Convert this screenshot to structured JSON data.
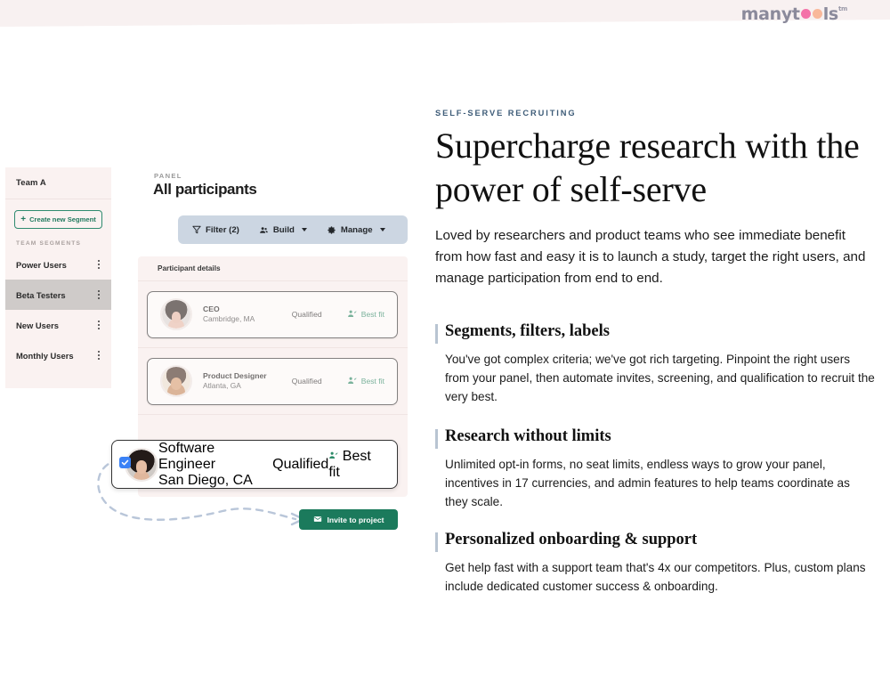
{
  "brand": {
    "logo_part1": "manyt",
    "logo_part2": "ls",
    "logo_tm": "tm",
    "dot_pink": "#f472a8",
    "dot_peach": "#f9b89a",
    "logo_text_color": "#8b8a9b"
  },
  "content": {
    "eyebrow": "SELF-SERVE RECRUITING",
    "eyebrow_color": "#3e5c78",
    "heading": "Supercharge research with the power of self-serve",
    "lede": "Loved by researchers and product teams who see immediate benefit from how fast and easy it is to launch a study, target the right users, and manage participation from end to end.",
    "features": [
      {
        "title": "Segments, filters, labels",
        "body": "You've got complex criteria; we've got rich targeting. Pinpoint the right users from your panel, then automate invites, screening, and qualification to recruit the very best."
      },
      {
        "title": "Research without limits",
        "body": "Unlimited opt-in forms, no seat limits, endless ways to grow your panel, incentives in 17 currencies, and admin features to help teams coordinate as they scale."
      },
      {
        "title": "Personalized onboarding & support",
        "body": "Get help fast with a support team that's 4x our competitors. Plus, custom plans include dedicated customer success & onboarding."
      }
    ],
    "accent_bar_color": "#b8c4d2"
  },
  "app_mock": {
    "sidebar": {
      "team_name": "Team A",
      "create_button": "Create new Segment",
      "create_button_color": "#217a5f",
      "section_label": "TEAM SEGMENTS",
      "items": [
        {
          "label": "Power Users",
          "active": false
        },
        {
          "label": "Beta Testers",
          "active": true
        },
        {
          "label": "New Users",
          "active": false
        },
        {
          "label": "Monthly Users",
          "active": false
        }
      ],
      "kebab_icon": "more-vertical-icon"
    },
    "panel": {
      "eyebrow": "PANEL",
      "title": "All participants",
      "toolbar_bg": "#ccd6e2",
      "toolbar": [
        {
          "label": "Filter (2)",
          "icon": "filter-icon",
          "caret": false
        },
        {
          "label": "Build",
          "icon": "people-icon",
          "caret": true
        },
        {
          "label": "Manage",
          "icon": "gear-icon",
          "caret": true
        }
      ],
      "list_header": "Participant details",
      "participants": [
        {
          "role": "CEO",
          "location": "Cambridge, MA",
          "status": "Qualified",
          "fit": "Best fit",
          "selected": false
        },
        {
          "role": "Product Designer",
          "location": "Atlanta, GA",
          "status": "Qualified",
          "fit": "Best fit",
          "selected": false
        },
        {
          "role": "Software Engineer",
          "location": "San Diego, CA",
          "status": "Qualified",
          "fit": "Best fit",
          "selected": true
        }
      ],
      "fit_color": "#2c8b68",
      "checkbox_color": "#3b82f6",
      "checkbox_checked": true,
      "invite_button": "Invite to project",
      "invite_button_color": "#1b7a5c",
      "invite_icon": "envelope-icon"
    }
  }
}
